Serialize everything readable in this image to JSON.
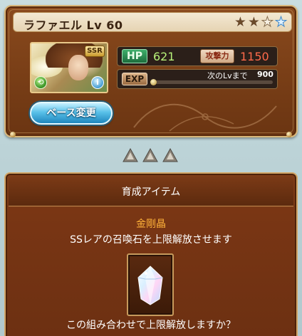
{
  "character": {
    "name": "ラファエル",
    "level_label": "Lv 60",
    "rarity": "SSR",
    "stars_filled": 2,
    "stars_total": 4,
    "hp_label": "HP",
    "hp_value": "621",
    "atk_label": "攻撃力",
    "atk_value": "1150",
    "exp_label": "EXP",
    "exp_next_label": "次のLvまで",
    "exp_next_value": "900",
    "exp_progress": 0.0
  },
  "buttons": {
    "base_change": "ベース変更"
  },
  "dialog": {
    "title": "育成アイテム",
    "item_name": "金剛晶",
    "item_description": "SSレアの召喚石を上限解放させます",
    "confirm_text": "この組み合わせで上限解放しますか？"
  },
  "colors": {
    "panel_brown": "#7a3f17",
    "hp_green": "#b7f27a",
    "atk_red": "#ff6a4a",
    "item_orange": "#ffb23a",
    "button_blue": "#59c1e9",
    "background": "#c9dde0"
  },
  "icons": {
    "element": "wind-element-icon",
    "info": "info-icon",
    "arrows": [
      "uncap-arrow-icon",
      "uncap-arrow-icon",
      "uncap-arrow-icon"
    ]
  }
}
